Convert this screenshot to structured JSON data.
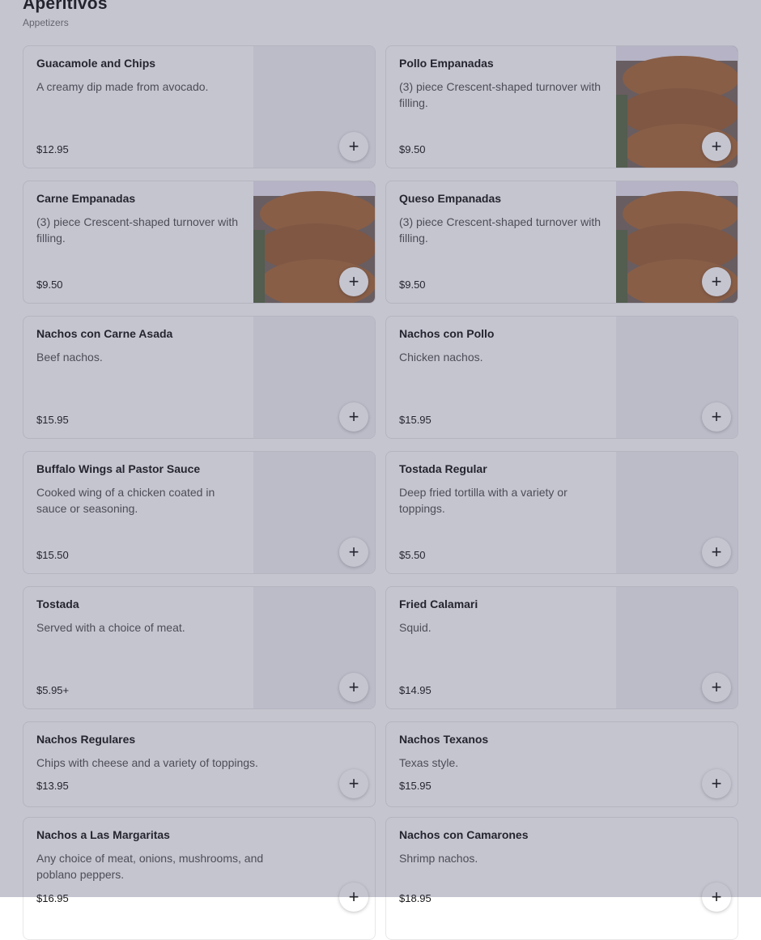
{
  "section": {
    "title": "Aperitivos",
    "subtitle": "Appetizers"
  },
  "items": [
    {
      "name": "Guacamole and Chips",
      "description": "A creamy dip made from avocado.",
      "price": "$12.95",
      "image": "none"
    },
    {
      "name": "Pollo Empanadas",
      "description": "(3) piece Crescent-shaped turnover with filling.",
      "price": "$9.50",
      "image": "empanadas-photo"
    },
    {
      "name": "Carne Empanadas",
      "description": "(3) piece Crescent-shaped turnover with filling.",
      "price": "$9.50",
      "image": "empanadas-photo"
    },
    {
      "name": "Queso Empanadas",
      "description": "(3) piece Crescent-shaped turnover with filling.",
      "price": "$9.50",
      "image": "empanadas-photo"
    },
    {
      "name": "Nachos con Carne Asada",
      "description": "Beef nachos.",
      "price": "$15.95",
      "image": "none"
    },
    {
      "name": "Nachos con Pollo",
      "description": "Chicken nachos.",
      "price": "$15.95",
      "image": "none"
    },
    {
      "name": "Buffalo Wings al Pastor Sauce",
      "description": "Cooked wing of a chicken coated in sauce or seasoning.",
      "price": "$15.50",
      "image": "none"
    },
    {
      "name": "Tostada Regular",
      "description": "Deep fried tortilla with a variety or toppings.",
      "price": "$5.50",
      "image": "none"
    },
    {
      "name": "Tostada",
      "description": "Served with a choice of meat.",
      "price": "$5.95+",
      "image": "none"
    },
    {
      "name": "Fried Calamari",
      "description": "Squid.",
      "price": "$14.95",
      "image": "none"
    },
    {
      "name": "Nachos Regulares",
      "description": "Chips with cheese and a variety of toppings.",
      "price": "$13.95"
    },
    {
      "name": "Nachos Texanos",
      "description": "Texas style.",
      "price": "$15.95"
    },
    {
      "name": "Nachos a Las Margaritas",
      "description": "Any choice of meat, onions, mushrooms, and poblano peppers.",
      "price": "$16.95"
    },
    {
      "name": "Nachos con Camarones",
      "description": "Shrimp nachos.",
      "price": "$18.95"
    }
  ],
  "add_icon": "plus-icon",
  "colors": {
    "overlay": "#3e3e64",
    "placeholder": "#f3f3f5",
    "empanada": "#a86c3c"
  }
}
